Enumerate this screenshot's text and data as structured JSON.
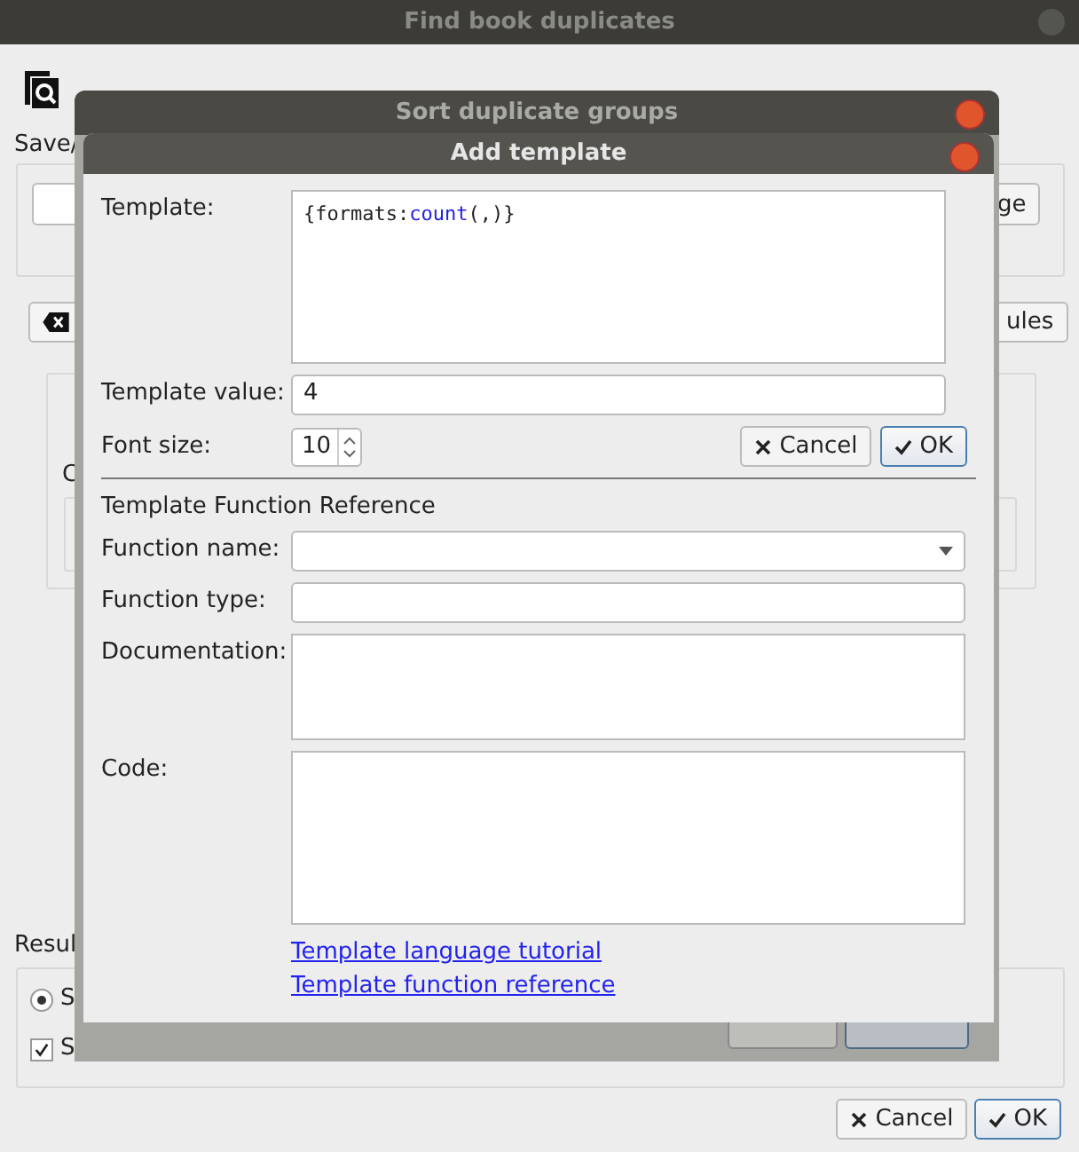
{
  "background_window": {
    "title": "Find book duplicates",
    "save_label": "Save/",
    "save_button": "ge",
    "rules_button": "ules",
    "group_label": "C",
    "results_label": "Resul",
    "radio": {
      "label": "S",
      "selected": true
    },
    "checkbox": {
      "label": "S",
      "checked": true
    },
    "buttons": [
      {
        "label": "Cancel",
        "kind": "cancel",
        "default": false
      },
      {
        "label": "OK",
        "kind": "ok",
        "default": true
      }
    ]
  },
  "middle_window": {
    "title": "Sort duplicate groups"
  },
  "dialog": {
    "title": "Add template",
    "template_label": "Template:",
    "template": [
      {
        "text": "{formats:",
        "kind": "plain"
      },
      {
        "text": "count",
        "kind": "function"
      },
      {
        "text": "(,)}",
        "kind": "plain"
      }
    ],
    "value_label": "Template value:",
    "value": "4",
    "font_size_label": "Font size:",
    "font_size": "10",
    "buttons": [
      {
        "label": "Cancel",
        "kind": "cancel",
        "default": false
      },
      {
        "label": "OK",
        "kind": "ok",
        "default": true
      }
    ],
    "section": "Template Function Reference",
    "fields": [
      {
        "label": "Function name:",
        "kind": "combo"
      },
      {
        "label": "Function type:",
        "kind": "line"
      },
      {
        "label": "Documentation:",
        "kind": "short_area"
      },
      {
        "label": "Code:",
        "kind": "tall_area"
      }
    ],
    "links": [
      "Template language tutorial",
      "Template function reference"
    ]
  }
}
